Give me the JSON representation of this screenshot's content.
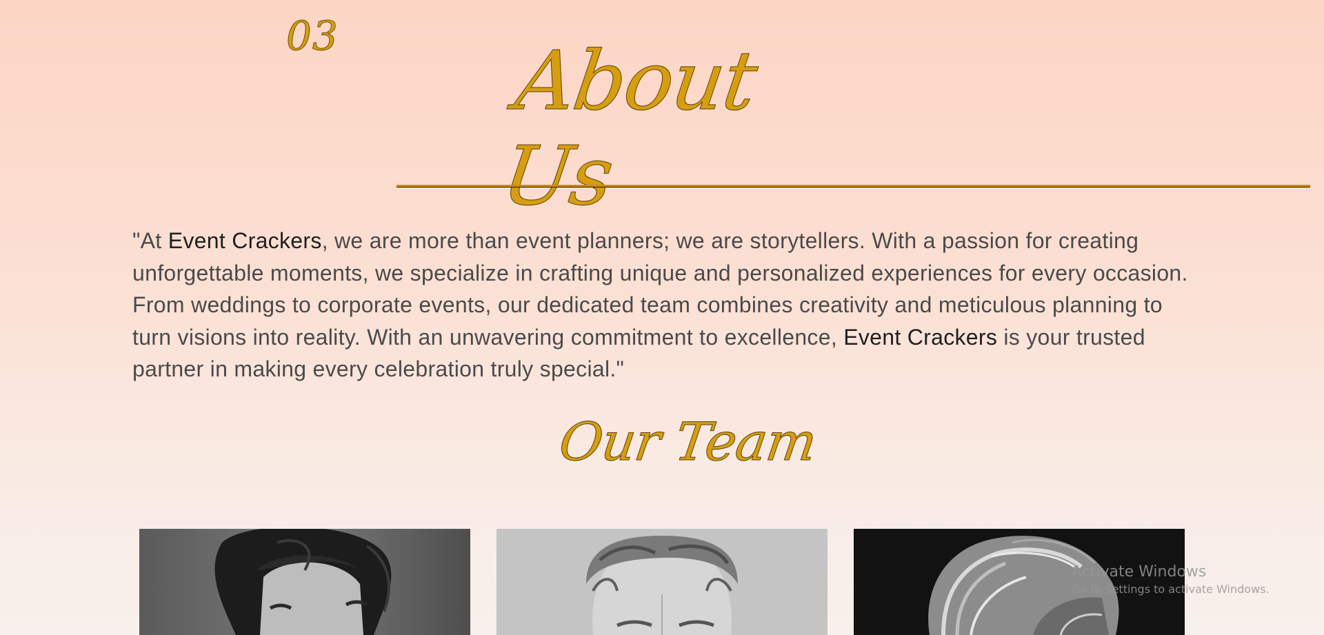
{
  "section": {
    "number": "03",
    "title": "About Us"
  },
  "about": {
    "p1": "\"At ",
    "brand1": "Event Crackers",
    "p2": ", we are more than event planners; we are storytellers. With a passion for creating unforgettable moments, we specialize in crafting unique and personalized experiences for every occasion. From weddings to corporate events, our dedicated team combines creativity and meticulous planning to turn visions into reality. With an unwavering commitment to excellence, ",
    "brand2": "Event Crackers",
    "p3": " is your trusted partner in making every celebration truly special.\""
  },
  "team": {
    "title": "Our Team",
    "members": [
      {
        "photo": "woman-portrait-bw"
      },
      {
        "photo": "man-portrait-bw"
      },
      {
        "photo": "blonde-portrait-bw"
      }
    ]
  },
  "watermark": {
    "title": "Activate Windows",
    "subtitle": "Go to Settings to activate Windows."
  },
  "colors": {
    "accent": "#d79d11",
    "text": "#4a4a4a",
    "brand_text": "#1f1f1f"
  }
}
